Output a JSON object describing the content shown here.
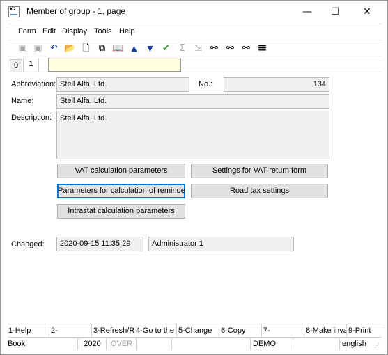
{
  "window": {
    "title": "Member of group - 1. page",
    "app_icon_text": "K2",
    "minimize_glyph": "—",
    "maximize_glyph": "☐",
    "close_glyph": "✕"
  },
  "menu": [
    "Form",
    "Edit",
    "Display",
    "Tools",
    "Help"
  ],
  "toolbar": [
    {
      "icon": "save-icon",
      "glyph": "▣",
      "enabled": false
    },
    {
      "icon": "save-as-icon",
      "glyph": "▣",
      "enabled": false
    },
    {
      "icon": "undo-icon",
      "glyph": "↶",
      "enabled": true
    },
    {
      "icon": "open-folder-icon",
      "glyph": "📂",
      "enabled": true
    },
    {
      "icon": "new-document-icon",
      "glyph": "🗋",
      "enabled": true
    },
    {
      "icon": "copy-icon",
      "glyph": "⧉",
      "enabled": true
    },
    {
      "icon": "book-icon",
      "glyph": "📖",
      "enabled": true
    },
    {
      "icon": "arrow-up-icon",
      "glyph": "▲",
      "enabled": true
    },
    {
      "icon": "arrow-down-icon",
      "glyph": "▼",
      "enabled": true
    },
    {
      "icon": "filter-check-icon",
      "glyph": "✔",
      "enabled": true
    },
    {
      "icon": "sum-icon",
      "glyph": "Σ",
      "enabled": false
    },
    {
      "icon": "clear-filter-icon",
      "glyph": "⇲",
      "enabled": false
    },
    {
      "icon": "binoculars-icon",
      "glyph": "⚯",
      "enabled": true
    },
    {
      "icon": "find-next-icon",
      "glyph": "⚯",
      "enabled": true
    },
    {
      "icon": "find-settings-icon",
      "glyph": "⚯",
      "enabled": true
    },
    {
      "icon": "hamburger-menu-icon",
      "glyph": "≡",
      "enabled": true
    }
  ],
  "tabs": [
    "0",
    "1"
  ],
  "form": {
    "abbreviation_label": "Abbreviation:",
    "abbreviation_value": "Stell Alfa, Ltd.",
    "no_label": "No.:",
    "no_value": "134",
    "name_label": "Name:",
    "name_value": "Stell Alfa, Ltd.",
    "description_label": "Description:",
    "description_value": "Stell Alfa, Ltd.",
    "changed_label": "Changed:",
    "changed_date": "2020-09-15 11:35:29",
    "changed_by": "Administrator 1"
  },
  "buttons": {
    "vat_calc": "VAT calculation parameters",
    "vat_return": "Settings for VAT return form",
    "reminders": "Parameters for calculation of reminders",
    "road_tax": "Road tax settings",
    "intrastat": "Intrastat calculation parameters"
  },
  "fkeys": [
    "1-Help",
    "2-",
    "3-Refresh/R",
    "4-Go to the",
    "5-Change",
    "6-Copy",
    "7-",
    "8-Make inva",
    "9-Print"
  ],
  "status": [
    "Book",
    "",
    "2020",
    "OVER",
    "",
    "",
    "DEMO",
    "",
    "english"
  ]
}
